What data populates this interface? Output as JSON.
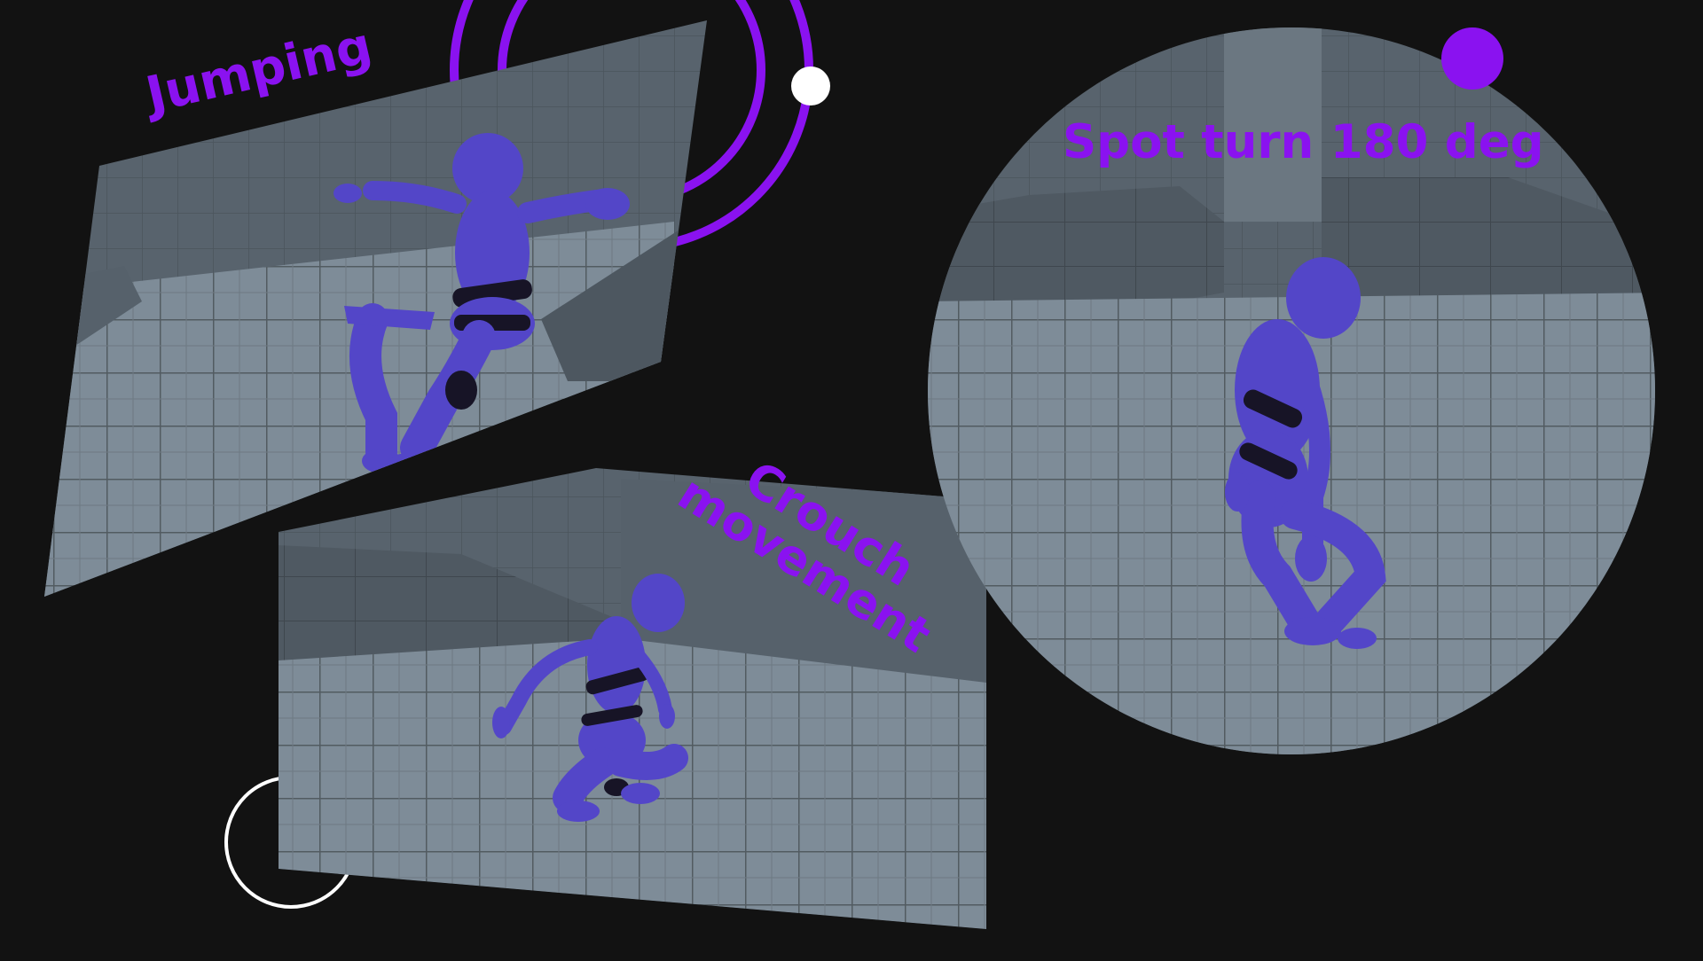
{
  "colors": {
    "background": "#121212",
    "accent": "#8a12f0",
    "ring_white": "#ffffff",
    "character_body": "#5346c8",
    "character_joint": "#171426",
    "floor": "#7e8c98",
    "wall": "#5a6670",
    "grid_line": "#50595f"
  },
  "panels": {
    "jumping": {
      "label": "Jumping"
    },
    "crouch": {
      "label_line1": "Crouch",
      "label_line2": "movement"
    },
    "spot_turn": {
      "label": "Spot turn 180 deg"
    }
  },
  "icons": [
    "purple-ring",
    "white-dot",
    "purple-dot",
    "white-ring"
  ]
}
